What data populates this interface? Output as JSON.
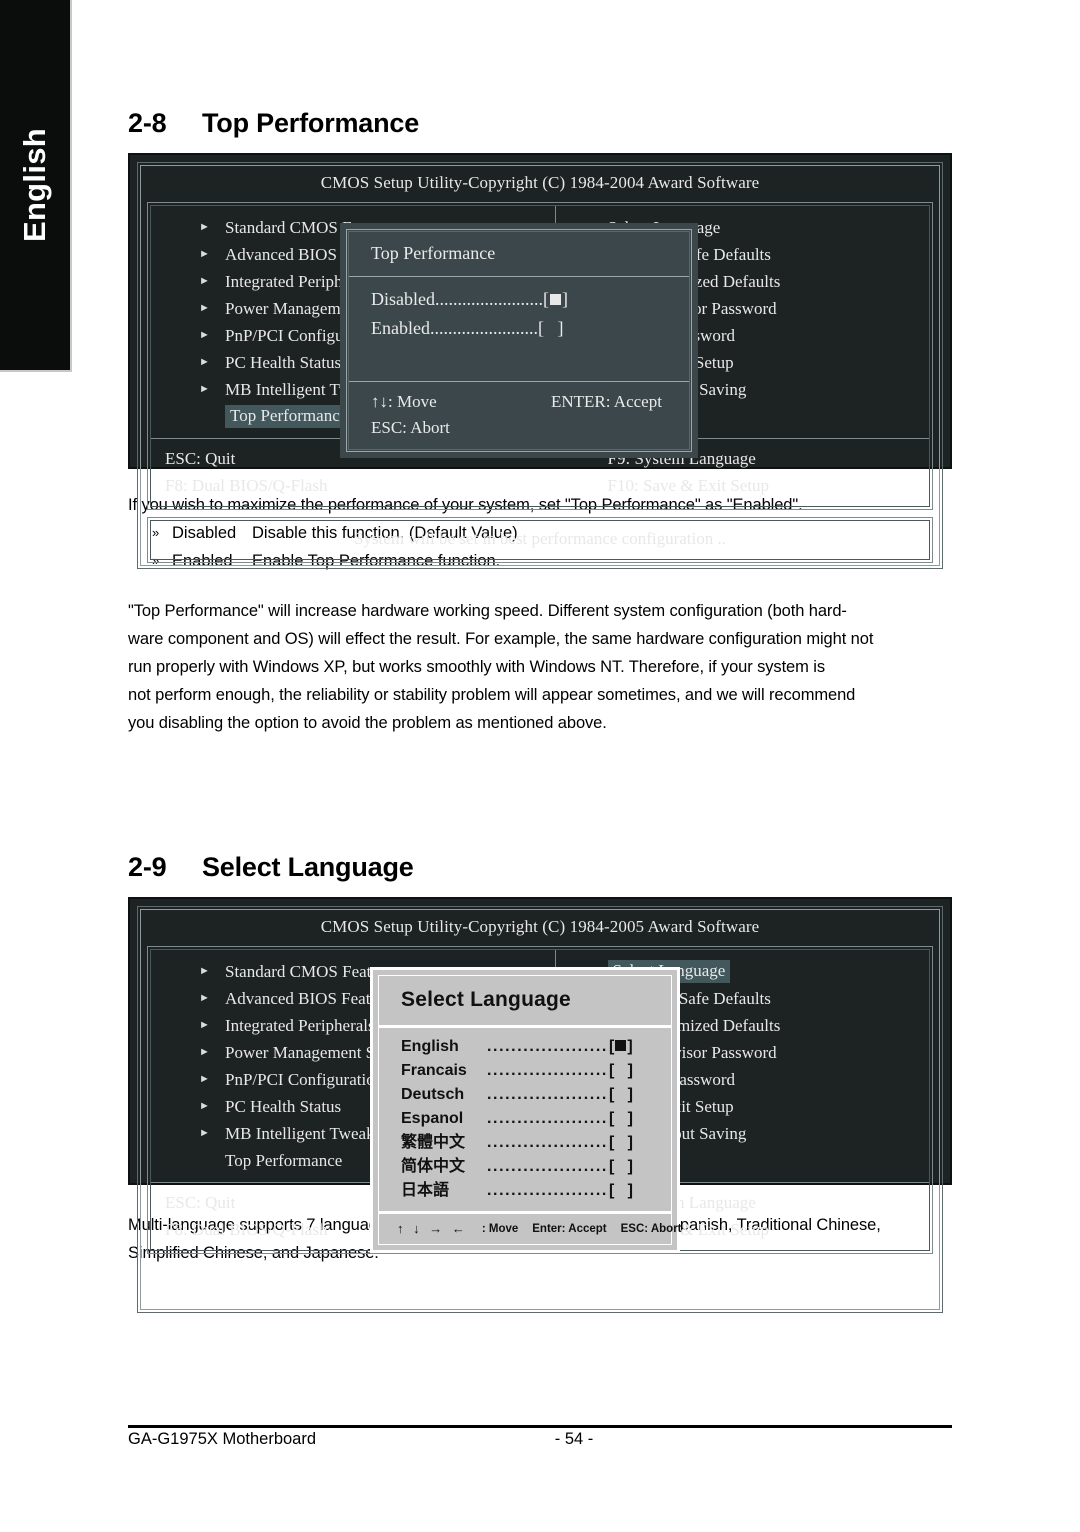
{
  "sidebar": {
    "lang_tab": "English"
  },
  "sections": {
    "s28": {
      "number": "2-8",
      "title": "Top Performance"
    },
    "s29": {
      "number": "2-9",
      "title": "Select Language"
    }
  },
  "bios1": {
    "title": "CMOS Setup Utility-Copyright (C) 1984-2004 Award Software",
    "left_items": [
      "Standard CMOS Features",
      "Advanced BIOS Features",
      "Integrated Peripherals",
      "Power Management Setup",
      "PnP/PCI Configurations",
      "PC Health Status",
      "MB Intelligent Tweaker(M.I.T.)",
      "Top Performance"
    ],
    "right_items": [
      "Select Language",
      "Load Fail-Safe Defaults",
      "Load Optimized Defaults",
      "Set Supervisor Password",
      "Set User Password",
      "Save & Exit Setup",
      "Exit Without Saving"
    ],
    "keys": {
      "esc_quit": "ESC: Quit",
      "f8": "F8: Dual BIOS/Q-Flash",
      "f9": "F9: System Language",
      "f10": "F10: Save & Exit Setup"
    },
    "status": "System will be set in best performance configuration .."
  },
  "dialog1": {
    "header": "Top Performance",
    "options": [
      {
        "label": "Disabled",
        "dots": "........................",
        "box_open": "[",
        "box_close": "]",
        "selected": true
      },
      {
        "label": "Enabled",
        "dots": "........................",
        "box_open": "[",
        "box_close": "]",
        "selected": false
      }
    ],
    "move": "↑↓: Move",
    "accept": "ENTER: Accept",
    "abort": "ESC: Abort"
  },
  "bios2": {
    "title": "CMOS Setup Utility-Copyright (C) 1984-2005 Award Software",
    "left_items": [
      "Standard CMOS Features",
      "Advanced BIOS Features",
      "Integrated Peripherals",
      "Power Management Setup",
      "PnP/PCI Configurations",
      "PC Health Status",
      "MB Intelligent Tweaker(M.I.T.)",
      "Top Performance"
    ],
    "right_items": [
      "Select Language",
      "Load Fail-Safe Defaults",
      "Load Optimized Defaults",
      "Set Supervisor Password",
      "Set User Password",
      "Save & Exit Setup",
      "Exit Without Saving"
    ],
    "keys": {
      "esc_quit": "ESC: Quit",
      "f8": "F8: Dual BIOS/Q-Flash",
      "f9": "F9: System Language",
      "f10": "F10: Save & Exit Setup"
    }
  },
  "dialog2": {
    "header": "Select Language",
    "dots": ".....................",
    "languages": [
      {
        "label": "English",
        "selected": true
      },
      {
        "label": "Francais",
        "selected": false
      },
      {
        "label": "Deutsch",
        "selected": false
      },
      {
        "label": "Espanol",
        "selected": false
      },
      {
        "label": "繁體中文",
        "selected": false
      },
      {
        "label": "简体中文",
        "selected": false
      },
      {
        "label": "日本語",
        "selected": false
      }
    ],
    "footer": {
      "arrows": "↑ ↓ → ←",
      "move": ": Move",
      "accept": "Enter: Accept",
      "abort": "ESC: Abort"
    }
  },
  "text": {
    "p28_intro": "If you wish to maximize the performance of your system, set \"Top Performance\" as \"Enabled\".",
    "opt_disabled_key": "Disabled",
    "opt_disabled_desc": "Disable this function. (Default Value)",
    "opt_enabled_key": "Enabled",
    "opt_enabled_desc": "Enable Top Performance function.",
    "p28_body_l1": "\"Top Performance\" will increase hardware working speed. Different system configuration (both hard-",
    "p28_body_l2": "ware component and OS) will effect the result. For example, the same hardware configuration might not",
    "p28_body_l3": "run properly with Windows XP, but works smoothly with Windows NT.  Therefore, if your system is",
    "p28_body_l4": "not perform enough, the reliability or stability problem will appear sometimes, and we will recommend",
    "p28_body_l5": "you disabling the option to avoid the problem as mentioned above.",
    "p29_body_l1": "Multi-language supports 7 languages. There are English, French, German, Spanish, Traditional Chinese,",
    "p29_body_l2": "Simplified Chinese, and Japanese."
  },
  "footer": {
    "left": "GA-G1975X Motherboard",
    "page": "- 54 -"
  },
  "colors": {
    "bios_bg": "#1d2223",
    "dialog_dark_bg": "#3b474a",
    "dialog_light_bg": "#c4c4c4",
    "highlight": "#42585c"
  }
}
